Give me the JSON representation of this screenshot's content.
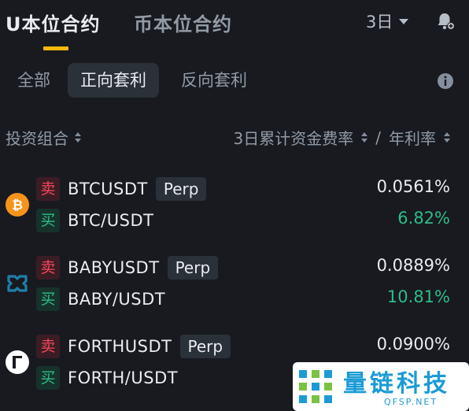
{
  "tabs": {
    "active": "U本位合约",
    "inactive": "币本位合约"
  },
  "period": {
    "label": "3日"
  },
  "filters": [
    "全部",
    "正向套利",
    "反向套利"
  ],
  "columns": {
    "portfolio": "投资组合",
    "rate": "3日累计资金费率",
    "separator": "/",
    "apr": "年利率"
  },
  "rows": [
    {
      "coin_icon": "bitcoin-icon",
      "perp_symbol": "BTCUSDT",
      "perp_tag": "Perp",
      "spot_symbol": "BTC/USDT",
      "sell": "卖",
      "buy": "买",
      "funding_rate": "0.0561%",
      "apr": "6.82%"
    },
    {
      "coin_icon": "babylon-icon",
      "perp_symbol": "BABYUSDT",
      "perp_tag": "Perp",
      "spot_symbol": "BABY/USDT",
      "sell": "卖",
      "buy": "买",
      "funding_rate": "0.0889%",
      "apr": "10.81%"
    },
    {
      "coin_icon": "forth-icon",
      "perp_symbol": "FORTHUSDT",
      "perp_tag": "Perp",
      "spot_symbol": "FORTH/USDT",
      "sell": "卖",
      "buy": "买",
      "funding_rate": "0.0900%",
      "apr": ""
    }
  ],
  "watermark": {
    "text": "量链科技",
    "sub": "QFSP.NET"
  },
  "colors": {
    "background": "#181a20",
    "accent": "#f0b90b",
    "sell": "#f6465d",
    "buy": "#2ebd85",
    "chip": "#2b3139"
  }
}
